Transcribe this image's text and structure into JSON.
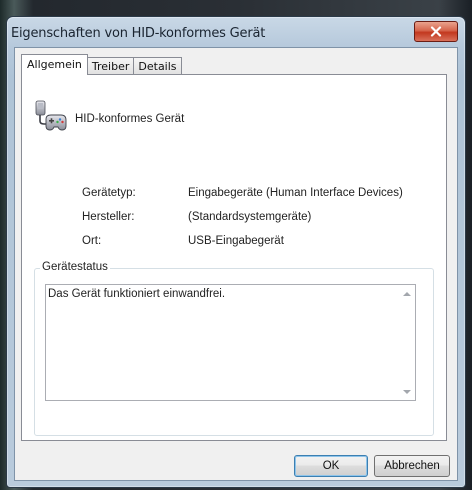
{
  "window": {
    "title": "Eigenschaften von HID-konformes Gerät"
  },
  "tabs": [
    {
      "label": "Allgemein",
      "active": true
    },
    {
      "label": "Treiber",
      "active": false
    },
    {
      "label": "Details",
      "active": false
    }
  ],
  "device": {
    "icon": "gamepad-device-icon",
    "name": "HID-konformes Gerät",
    "properties": [
      {
        "label": "Gerätetyp:",
        "value": "Eingabegeräte (Human Interface Devices)"
      },
      {
        "label": "Hersteller:",
        "value": "(Standardsystemgeräte)"
      },
      {
        "label": "Ort:",
        "value": "USB-Eingabegerät"
      }
    ]
  },
  "status": {
    "label": "Gerätestatus",
    "text": "Das Gerät funktioniert einwandfrei."
  },
  "buttons": {
    "ok": "OK",
    "cancel": "Abbrechen"
  },
  "colors": {
    "close_button": "#c2381f",
    "title_bar": "#b6c9dc",
    "dialog_bg": "#f0f0f0"
  }
}
